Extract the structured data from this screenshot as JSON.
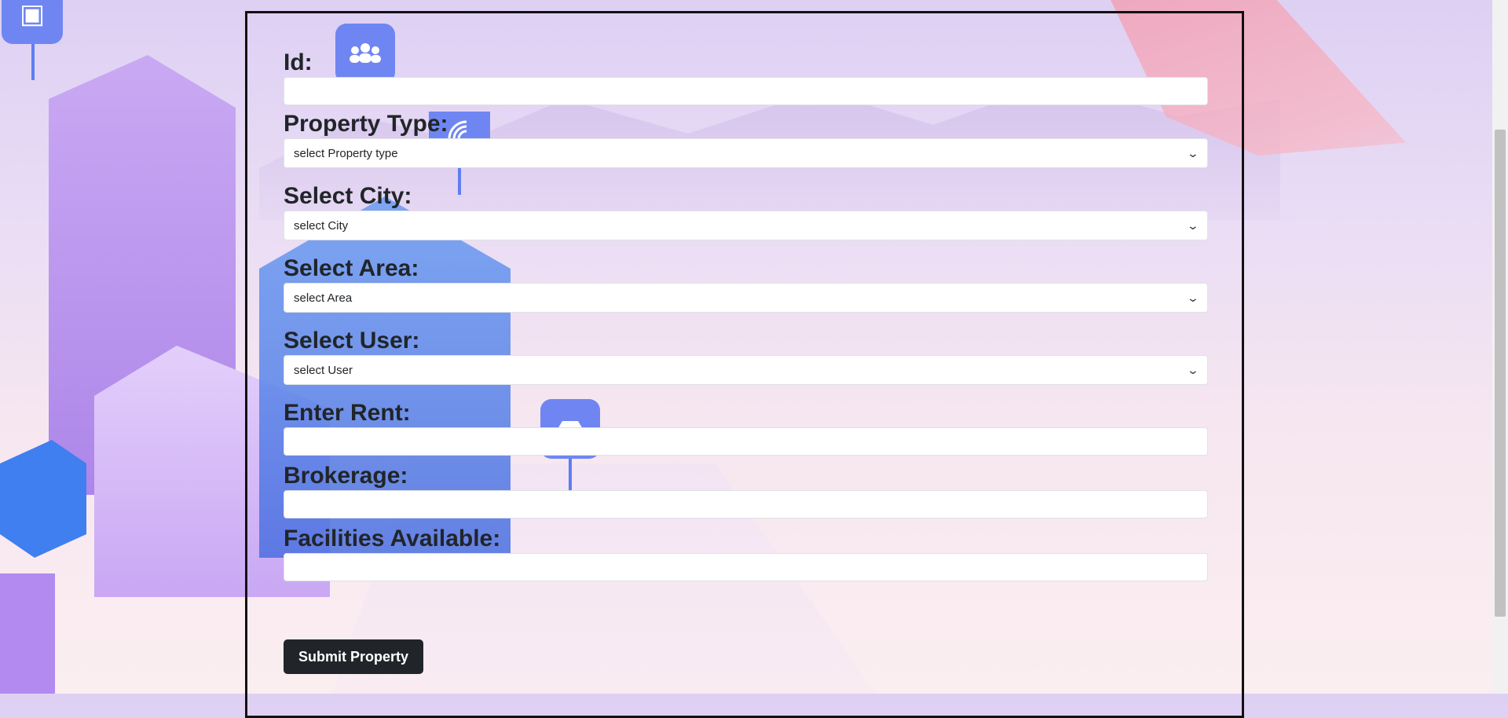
{
  "form": {
    "id_label": "Id:",
    "id_value": "",
    "property_type_label": "Property Type:",
    "property_type_selected": "select Property type",
    "city_label": "Select City:",
    "city_selected": "select City",
    "area_label": "Select Area:",
    "area_selected": "select Area",
    "user_label": "Select User:",
    "user_selected": "select User",
    "rent_label": "Enter Rent:",
    "rent_value": "",
    "brokerage_label": "Brokerage:",
    "brokerage_value": "",
    "facilities_label": "Facilities Available:",
    "facilities_value": "",
    "submit_label": "Submit Property"
  },
  "icons": {
    "chevron": "chevron-down-icon",
    "background_pins": [
      "video-icon",
      "users-icon",
      "wifi-icon",
      "car-icon"
    ]
  },
  "colors": {
    "button_bg": "#212529",
    "panel_border": "#111111",
    "pin_blue": "#6f86f2"
  }
}
